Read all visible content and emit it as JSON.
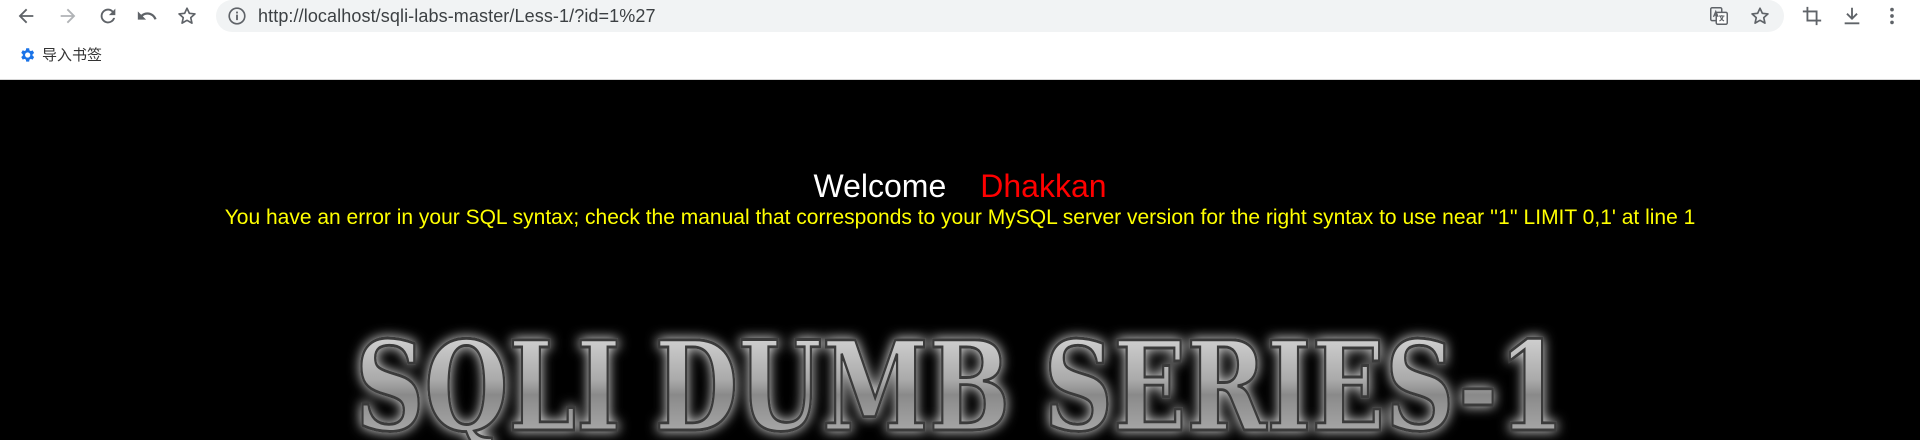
{
  "browser": {
    "url": "http://localhost/sqli-labs-master/Less-1/?id=1%27",
    "bookmarks": [
      {
        "label": "导入书签",
        "icon": "gear-icon"
      }
    ],
    "colors": {
      "omnibox_bg": "#f1f3f4",
      "icon": "#5f6368",
      "bookmark_icon": "#1a73e8"
    }
  },
  "page": {
    "welcome": "Welcome",
    "name": "Dhakkan",
    "error": "You have an error in your SQL syntax; check the manual that corresponds to your MySQL server version for the right syntax to use near ''1'' LIMIT 0,1' at line 1",
    "banner": "SQLI DUMB SERIES-1",
    "colors": {
      "background": "#000000",
      "welcome": "#ffffff",
      "name": "#ff0000",
      "error": "#ffff00"
    }
  }
}
